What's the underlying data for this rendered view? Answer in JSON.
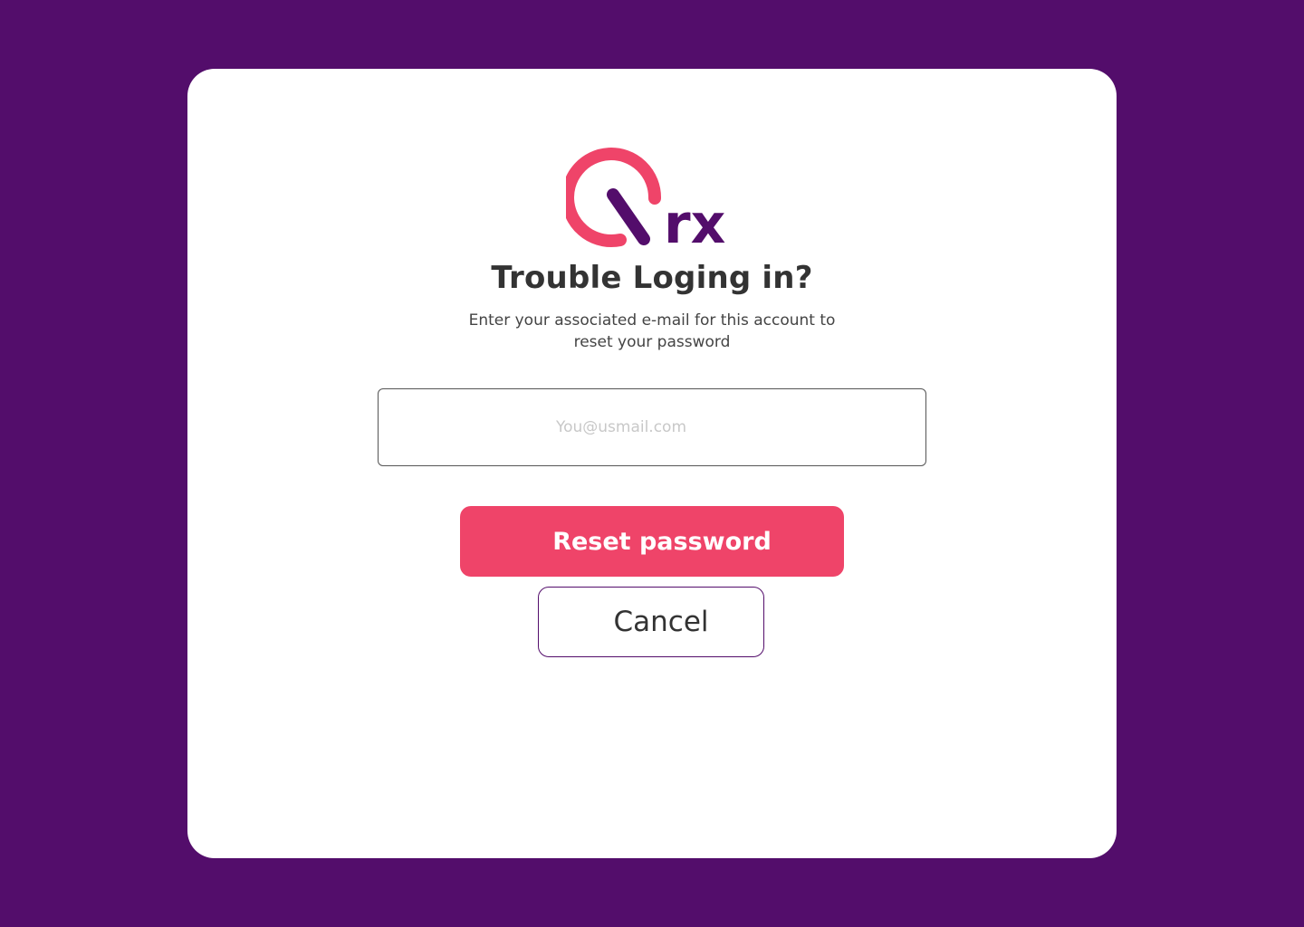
{
  "brand": {
    "logo_text": "rx",
    "ring_color": "#ef4469",
    "accent_color": "#530d6b"
  },
  "page": {
    "background_color": "#530d6b"
  },
  "content": {
    "title": "Trouble Loging in?",
    "subtitle": "Enter  your associated e-mail for this account to\nreset your password"
  },
  "form": {
    "email_placeholder": "You@usmail.com",
    "email_value": ""
  },
  "actions": {
    "reset_label": "Reset password",
    "cancel_label": "Cancel"
  }
}
